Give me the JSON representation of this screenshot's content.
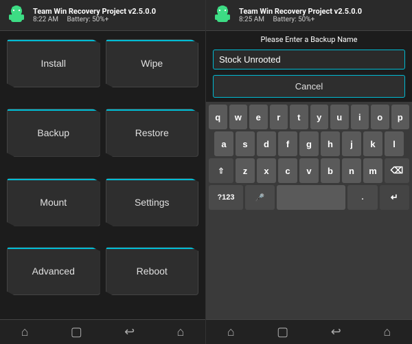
{
  "left": {
    "header": {
      "title": "Team Win Recovery Project  v2.5.0.0",
      "time": "8:22 AM",
      "battery": "Battery: 50%+"
    },
    "buttons": [
      {
        "id": "install",
        "label": "Install"
      },
      {
        "id": "wipe",
        "label": "Wipe"
      },
      {
        "id": "backup",
        "label": "Backup"
      },
      {
        "id": "restore",
        "label": "Restore"
      },
      {
        "id": "mount",
        "label": "Mount"
      },
      {
        "id": "settings",
        "label": "Settings"
      },
      {
        "id": "advanced",
        "label": "Advanced"
      },
      {
        "id": "reboot",
        "label": "Reboot"
      }
    ],
    "bottomIcons": [
      "home",
      "square",
      "back",
      "home2"
    ]
  },
  "right": {
    "header": {
      "title": "Team Win Recovery Project  v2.5.0.0",
      "time": "8:25 AM",
      "battery": "Battery: 50%+"
    },
    "prompt": "Please Enter a Backup Name",
    "inputValue": "Stock Unrooted",
    "cancelLabel": "Cancel",
    "keyboard": {
      "rows": [
        [
          "q",
          "w",
          "e",
          "r",
          "t",
          "y",
          "u",
          "i",
          "o",
          "p"
        ],
        [
          "a",
          "s",
          "d",
          "f",
          "g",
          "h",
          "j",
          "k",
          "l"
        ],
        [
          "z",
          "x",
          "c",
          "v",
          "b",
          "n",
          "m"
        ]
      ],
      "specialLeft": "⇧",
      "specialRight": "⌫",
      "bottomLeft": "?123",
      "mic": "🎤",
      "period": ".",
      "enter": "↵"
    }
  },
  "colors": {
    "accent": "#00bcd4",
    "bg": "#1c1c1c",
    "headerBg": "#2a2a2a",
    "keyBg": "#5a5a5a",
    "kbBg": "#3a3a3a"
  }
}
